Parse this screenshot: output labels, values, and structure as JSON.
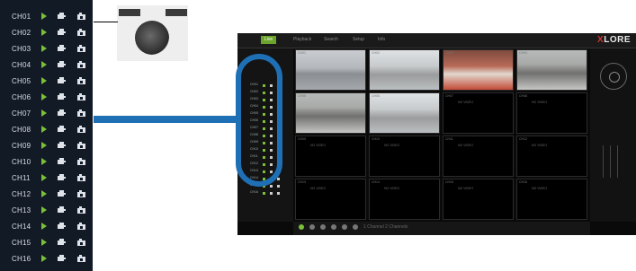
{
  "channels": [
    {
      "label": "CH01"
    },
    {
      "label": "CH02"
    },
    {
      "label": "CH03"
    },
    {
      "label": "CH04"
    },
    {
      "label": "CH05"
    },
    {
      "label": "CH06"
    },
    {
      "label": "CH07"
    },
    {
      "label": "CH08"
    },
    {
      "label": "CH09"
    },
    {
      "label": "CH10"
    },
    {
      "label": "CH11"
    },
    {
      "label": "CH12"
    },
    {
      "label": "CH13"
    },
    {
      "label": "CH14"
    },
    {
      "label": "CH15"
    },
    {
      "label": "CH16"
    }
  ],
  "channel_icons": [
    "play-icon",
    "camera-icon",
    "record-icon"
  ],
  "dvr": {
    "tabs": [
      "Live",
      "Playback",
      "Search",
      "Setup",
      "Info"
    ],
    "logo_text": "LORE",
    "logo_accent": "X",
    "tiles_no_video": "NO VIDEO",
    "bottom_text": "1 Channel 2 Channels"
  },
  "colors": {
    "accent_blue": "#1f6fb5",
    "play_green": "#7bbf3a",
    "live_tab": "#6ba42d",
    "brand_red": "#d7322f"
  }
}
